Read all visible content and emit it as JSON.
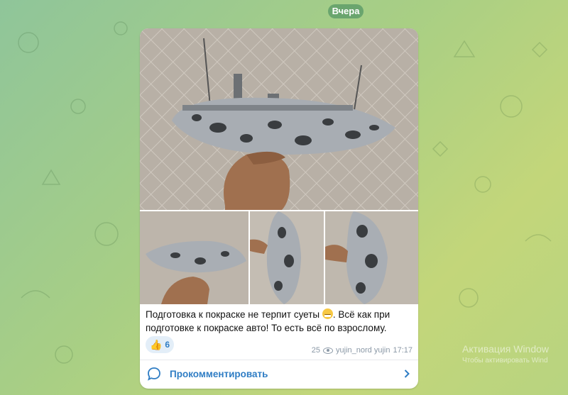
{
  "date_chip": "Вчера",
  "post": {
    "caption_part1": "Подготовка к покраске не терпит суеты ",
    "caption_emoji": "grinning-face-emoji",
    "caption_part2": ". Всё как при подготовке к покраске авто! То есть всё по взрослому.",
    "reaction": {
      "icon": "thumbs-up-emoji",
      "emoji": "👍",
      "count": "6"
    },
    "views": "25",
    "author": "yujin_nord yujin",
    "time": "17:17",
    "comment_label": "Прокомментировать"
  },
  "watermark": {
    "title": "Активация Window",
    "subtitle": "Чтобы активировать Wind"
  },
  "colors": {
    "accent": "#2f7dc4",
    "date_chip_bg": "#6aa56e",
    "reaction_bg": "#e3eef8"
  }
}
